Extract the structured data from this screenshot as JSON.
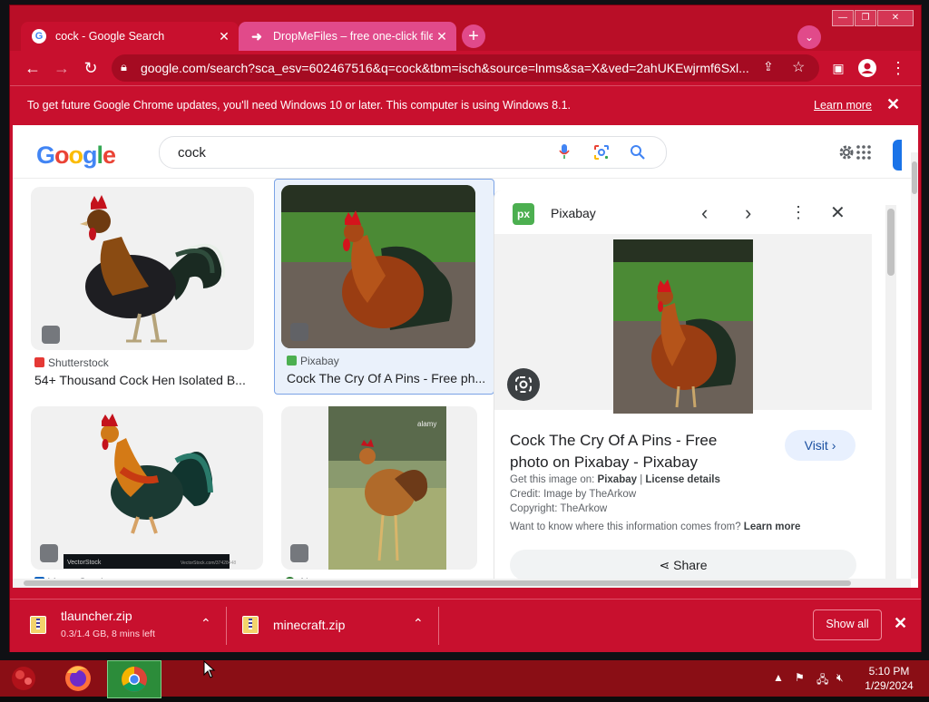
{
  "browser": {
    "tabs": [
      {
        "title": "cock - Google Search",
        "favicon": "google-g-icon",
        "active": true
      },
      {
        "title": "DropMeFiles – free one-click file",
        "favicon": "arrow-right-icon",
        "active": false
      }
    ],
    "url": "google.com/search?sca_esv=602467516&q=cock&tbm=isch&source=lnms&sa=X&ved=2ahUKEwjrmf6Sxl...",
    "accent_color": "#c8102e"
  },
  "infobar": {
    "message": "To get future Google Chrome updates, you'll need Windows 10 or later. This computer is using Windows 8.1.",
    "link": "Learn more"
  },
  "google": {
    "logo": "Google",
    "query": "cock"
  },
  "results": [
    {
      "source": "Shutterstock",
      "caption": "54+ Thousand Cock Hen Isolated B...",
      "source_color": "#e53935"
    },
    {
      "source": "Pixabay",
      "caption": "Cock The Cry Of A Pins - Free ph...",
      "source_color": "#4caf50",
      "selected": true
    },
    {
      "source": "VectorStock",
      "caption": "",
      "source_color": "#1565c0",
      "watermark_left": "VectorStock",
      "watermark_right": "VectorStock.com/37428448"
    },
    {
      "source": "Alamy",
      "caption": "",
      "source_color": "#2e7d32",
      "watermark": "alamy"
    }
  ],
  "panel": {
    "site": "Pixabay",
    "site_icon": "px",
    "title": "Cock The Cry Of A Pins - Free photo on Pixabay - Pixabay",
    "visit": "Visit",
    "get_image_label": "Get this image on:",
    "get_image_site": "Pixabay",
    "license": "License details",
    "credit": "Credit: Image by TheArkow",
    "copyright": "Copyright: TheArkow",
    "question": "Want to know where this information comes from?",
    "question_link": "Learn more",
    "share": "Share"
  },
  "downloads": {
    "items": [
      {
        "name": "tlauncher.zip",
        "status": "0.3/1.4 GB, 8 mins left"
      },
      {
        "name": "minecraft.zip",
        "status": ""
      }
    ],
    "show_all": "Show all"
  },
  "taskbar": {
    "time": "5:10 PM",
    "date": "1/29/2024"
  }
}
